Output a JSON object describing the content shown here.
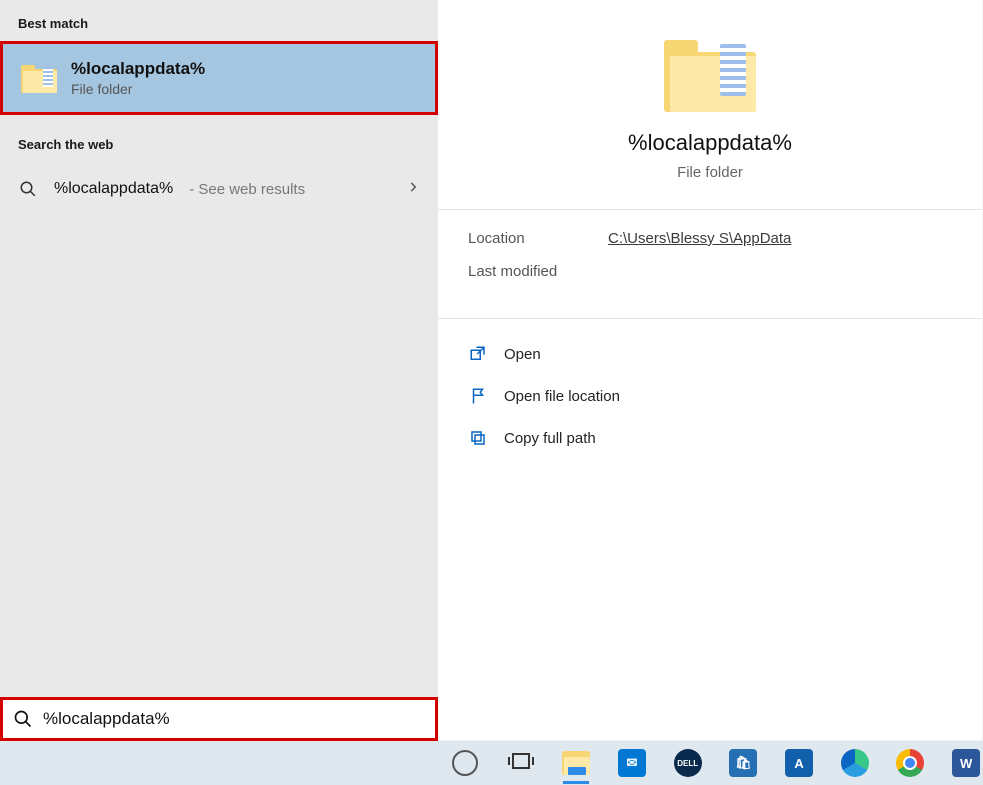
{
  "left": {
    "best_match_label": "Best match",
    "best_match": {
      "title": "%localappdata%",
      "subtitle": "File folder"
    },
    "web_label": "Search the web",
    "web_result": {
      "text": "%localappdata%",
      "hint": " - See web results"
    }
  },
  "detail": {
    "title": "%localappdata%",
    "subtitle": "File folder",
    "location_label": "Location",
    "location_value": "C:\\Users\\Blessy S\\AppData",
    "modified_label": "Last modified",
    "modified_value": "",
    "actions": {
      "open": "Open",
      "open_loc": "Open file location",
      "copy_path": "Copy full path"
    }
  },
  "search": {
    "value": "%localappdata%"
  },
  "taskbar": {
    "word_label": "W",
    "a_label": "A",
    "mail_glyph": "✉",
    "dell_label": "DELL",
    "store_glyph": "🛍"
  }
}
